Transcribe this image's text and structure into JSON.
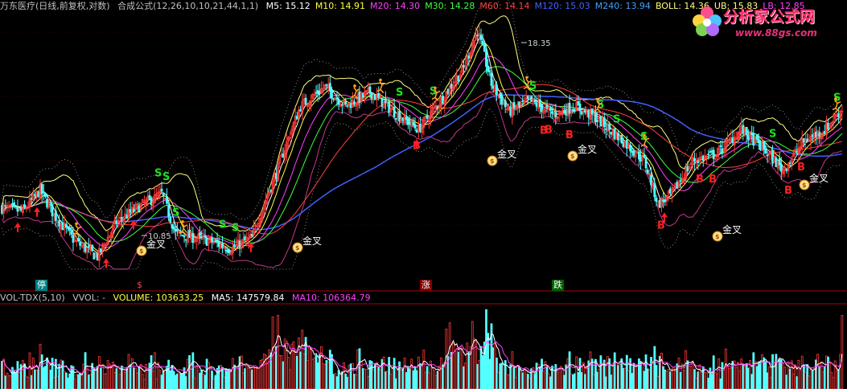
{
  "header": {
    "stock": "万东医疗(日线,前复权,对数)",
    "formula": "合成公式(12,26,10,10,21,44,1,1)",
    "indicators": [
      {
        "label": "M5: 15.12",
        "color": "#ffffff"
      },
      {
        "label": "M10: 14.91",
        "color": "#ffff40"
      },
      {
        "label": "M20: 14.30",
        "color": "#ff40ff"
      },
      {
        "label": "M30: 14.28",
        "color": "#40ff40"
      },
      {
        "label": "M60: 14.14",
        "color": "#ff4040"
      },
      {
        "label": "M120: 15.03",
        "color": "#4060ff"
      },
      {
        "label": "M240: 13.94",
        "color": "#40a0ff"
      },
      {
        "label": "BOLL: 14.36",
        "color": "#ffff80"
      },
      {
        "label": "UB: 15.83",
        "color": "#ffff80"
      },
      {
        "label": "LB: 12.85",
        "color": "#ff40ff"
      }
    ]
  },
  "volume_header": {
    "name": "VOL-TDX(5,10)",
    "vvol": "VVOL: -",
    "volume": "VOLUME: 103633.25",
    "ma5": "MA5: 147579.84",
    "ma10": "MA10: 106364.79"
  },
  "watermark": {
    "title": "分析家公式网",
    "url": "www.88gs.com"
  },
  "events": [
    {
      "label": "停",
      "bg": "#008080",
      "color": "#ffffff"
    },
    {
      "label": "$",
      "bg": "",
      "color": "#ff4040"
    },
    {
      "label": "涨",
      "bg": "#800000",
      "color": "#ffffff"
    },
    {
      "label": "跌",
      "bg": "#006000",
      "color": "#ffffff"
    }
  ],
  "annotations": {
    "high": "18.35",
    "low": "10.85",
    "golden_cross": "金叉",
    "buy": "B",
    "sell": "S"
  },
  "colors": {
    "up": "#ff3b3b",
    "down": "#54ffff",
    "ma5": "#ffffff",
    "ma10": "#ffff40",
    "ma20": "#ff40ff",
    "ma30": "#40ff40",
    "ma60": "#ff4040",
    "ma120": "#4060ff",
    "boll": "#ffff80",
    "lb": "#ff40ff",
    "divider": "#b00000"
  },
  "chart_data": {
    "type": "candlestick",
    "scale": "log",
    "y_range": [
      10.5,
      19.0
    ],
    "low_label": 10.85,
    "high_label": 18.35,
    "pivots": [
      [
        0,
        12.2
      ],
      [
        12,
        12.1
      ],
      [
        22,
        12.7
      ],
      [
        30,
        12.0
      ],
      [
        42,
        11.3
      ],
      [
        55,
        10.9
      ],
      [
        66,
        11.8
      ],
      [
        78,
        12.2
      ],
      [
        92,
        12.6
      ],
      [
        100,
        11.5
      ],
      [
        120,
        11.3
      ],
      [
        132,
        11.1
      ],
      [
        144,
        11.4
      ],
      [
        158,
        13.2
      ],
      [
        172,
        15.4
      ],
      [
        186,
        16.1
      ],
      [
        198,
        15.4
      ],
      [
        212,
        15.9
      ],
      [
        228,
        15.1
      ],
      [
        240,
        14.6
      ],
      [
        254,
        15.7
      ],
      [
        266,
        16.8
      ],
      [
        274,
        18.3
      ],
      [
        282,
        16.2
      ],
      [
        292,
        15.2
      ],
      [
        304,
        15.6
      ],
      [
        318,
        15.1
      ],
      [
        330,
        15.4
      ],
      [
        342,
        15.0
      ],
      [
        356,
        14.3
      ],
      [
        370,
        13.6
      ],
      [
        378,
        12.3
      ],
      [
        386,
        12.6
      ],
      [
        398,
        13.6
      ],
      [
        412,
        13.8
      ],
      [
        426,
        14.6
      ],
      [
        438,
        14.0
      ],
      [
        450,
        13.3
      ],
      [
        462,
        14.2
      ],
      [
        474,
        14.6
      ],
      [
        484,
        15.3
      ]
    ],
    "volume_max": 400000,
    "volume_last": 103633.25
  },
  "markers": {
    "buy_arrows": [
      22,
      46,
      132,
      166,
      312,
      518,
      826
    ],
    "buy_labels": [
      518,
      682,
      676,
      708,
      822,
      870,
      886,
      980,
      996
    ],
    "sell_s": [
      496,
      538,
      662,
      746,
      766,
      800,
      960,
      1040,
      292,
      276,
      218,
      206,
      196
    ],
    "runners": [
      472,
      540,
      654,
      742,
      800,
      94,
      226,
      440,
      1038
    ],
    "golden_cross": [
      [
        176,
        304
      ],
      [
        370,
        300
      ],
      [
        612,
        192
      ],
      [
        712,
        186
      ],
      [
        892,
        286
      ],
      [
        1000,
        222
      ]
    ]
  }
}
